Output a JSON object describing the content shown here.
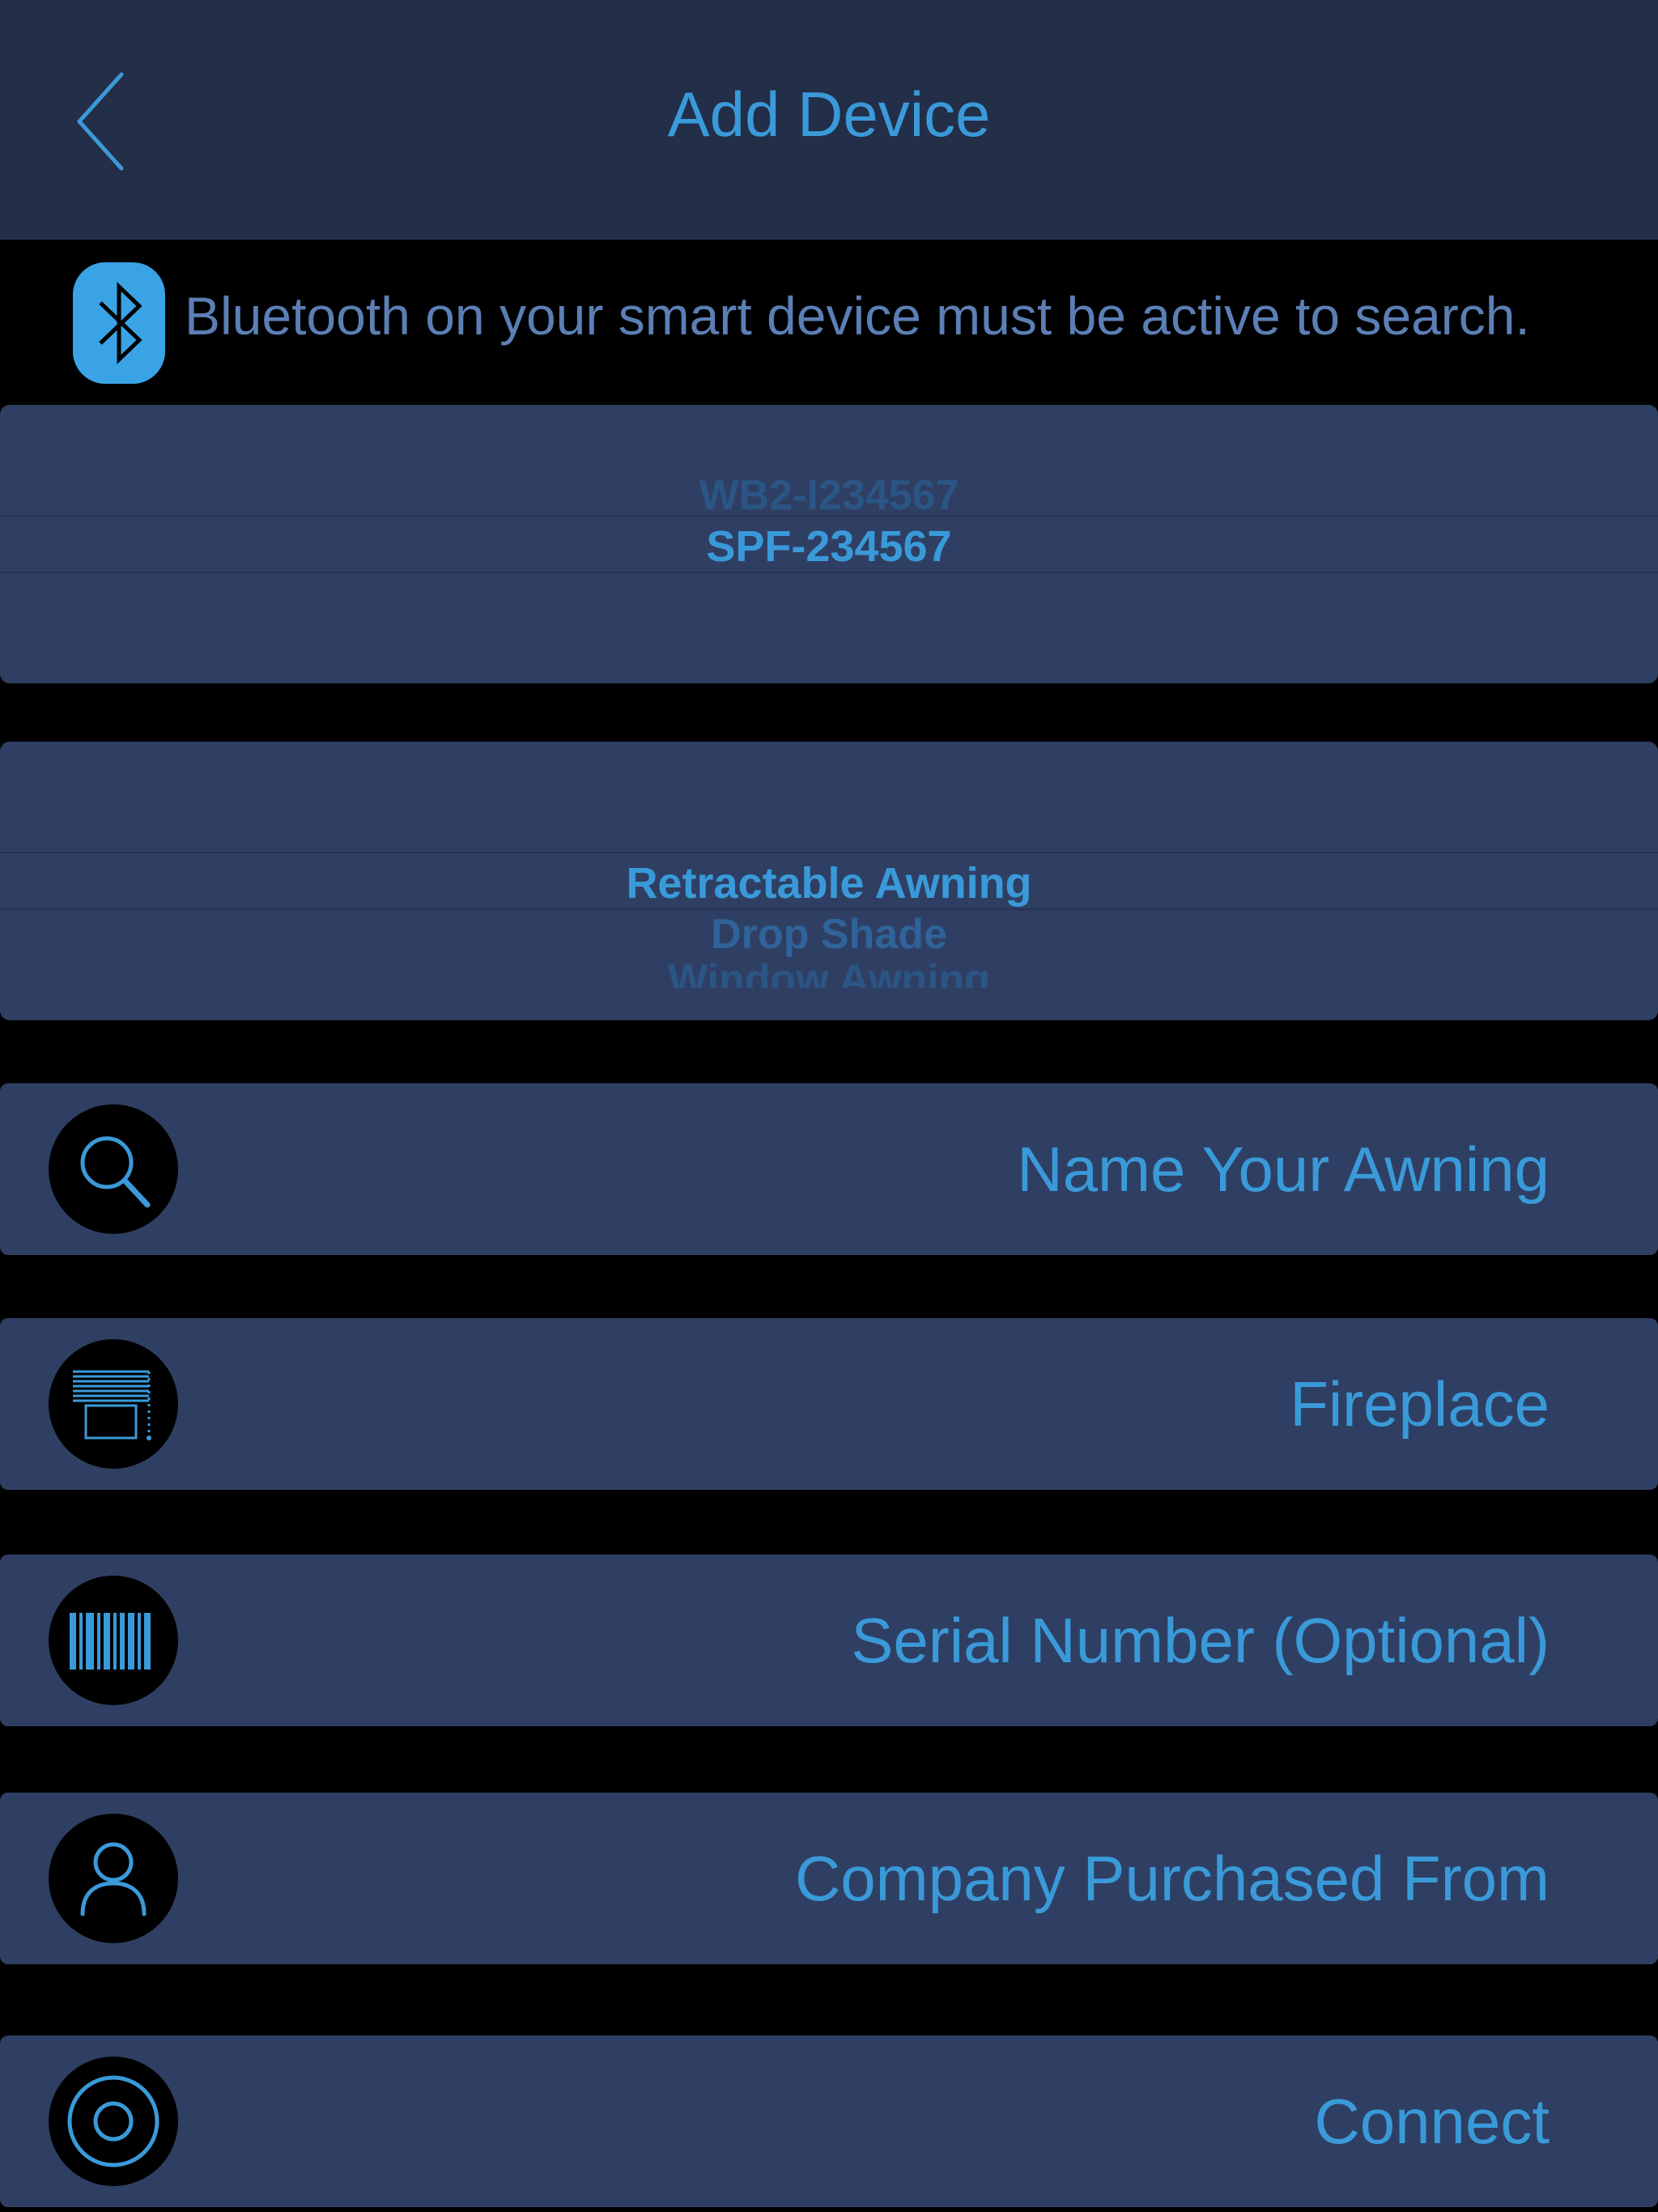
{
  "header": {
    "title": "Add Device"
  },
  "bluetooth_notice": {
    "text": "Bluetooth on your smart device must be active to search."
  },
  "device_picker": {
    "options_above": [
      "WB2-I234567"
    ],
    "selected": "SPF-234567"
  },
  "type_picker": {
    "selected": "Retractable Awning",
    "options_below": [
      "Drop Shade",
      "Window Awning"
    ]
  },
  "rows": {
    "name": "Name Your Awning",
    "location": "Fireplace",
    "serial": "Serial Number (Optional)",
    "company": "Company Purchased From",
    "connect": "Connect"
  },
  "colors": {
    "accent": "#3a9ad9",
    "header_bg": "#232e48",
    "row_bg": "#2f3f63",
    "background": "#000000"
  }
}
